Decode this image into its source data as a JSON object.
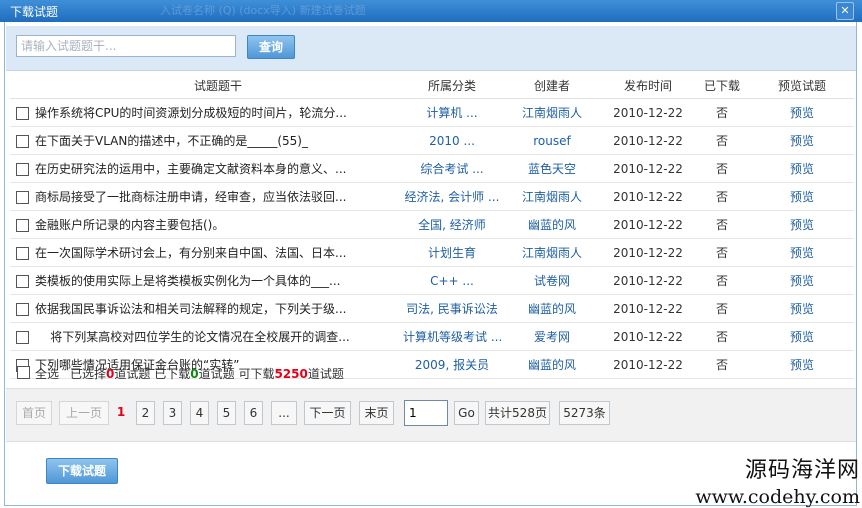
{
  "window": {
    "title": "下载试题",
    "ghost_text": "入试卷名称 (Q) (docx导入) 新建试卷试题"
  },
  "search": {
    "placeholder": "请输入试题题干...",
    "button_label": "查询"
  },
  "table": {
    "headers": [
      "",
      "试题题干",
      "所属分类",
      "创建者",
      "发布时间",
      "已下载",
      "预览试题"
    ],
    "rows": [
      {
        "title": "操作系统将CPU的时间资源划分成极短的时间片，轮流分...",
        "category": "计算机 ...",
        "author": "江南烟雨人",
        "date": "2010-12-22",
        "downloaded": "否",
        "preview": "预览"
      },
      {
        "title": "在下面关于VLAN的描述中，不正确的是_____(55)_",
        "category": "2010 ...",
        "author": "rousef",
        "date": "2010-12-22",
        "downloaded": "否",
        "preview": "预览"
      },
      {
        "title": "在历史研究法的运用中，主要确定文献资料本身的意义、...",
        "category": "综合考试 ...",
        "author": "蓝色天空",
        "date": "2010-12-22",
        "downloaded": "否",
        "preview": "预览"
      },
      {
        "title": "商标局接受了一批商标注册申请，经审查，应当依法驳回...",
        "category": "经济法, 会计师 ...",
        "author": "江南烟雨人",
        "date": "2010-12-22",
        "downloaded": "否",
        "preview": "预览"
      },
      {
        "title": "金融账户所记录的内容主要包括()。",
        "category": "全国, 经济师",
        "author": "幽蓝的风",
        "date": "2010-12-22",
        "downloaded": "否",
        "preview": "预览"
      },
      {
        "title": "在一次国际学术研讨会上，有分别来自中国、法国、日本...",
        "category": "计划生育",
        "author": "江南烟雨人",
        "date": "2010-12-22",
        "downloaded": "否",
        "preview": "预览"
      },
      {
        "title": "类模板的使用实际上是将类模板实例化为一个具体的___...",
        "category": "C++ ...",
        "author": "试卷网",
        "date": "2010-12-22",
        "downloaded": "否",
        "preview": "预览"
      },
      {
        "title": "依据我国民事诉讼法和相关司法解释的规定，下列关于级...",
        "category": "司法, 民事诉讼法",
        "author": "幽蓝的风",
        "date": "2010-12-22",
        "downloaded": "否",
        "preview": "预览"
      },
      {
        "title": "    将下列某高校对四位学生的论文情况在全校展开的调查...",
        "category": "计算机等级考试 ...",
        "author": "爱考网",
        "date": "2010-12-22",
        "downloaded": "否",
        "preview": "预览"
      },
      {
        "title": "下列哪些情况适用保证金台账的“实转”",
        "category": "2009, 报关员",
        "author": "幽蓝的风",
        "date": "2010-12-22",
        "downloaded": "否",
        "preview": "预览"
      }
    ]
  },
  "selection": {
    "select_all_label": "全选",
    "selected_prefix": "已选择",
    "selected_count": "0",
    "selected_suffix": "道试题",
    "downloaded_prefix": "已下载",
    "downloaded_count": "0",
    "downloaded_suffix": "道试题",
    "available_prefix": "可下载",
    "available_count": "5250",
    "available_suffix": "道试题"
  },
  "pager": {
    "first": "首页",
    "prev": "上一页",
    "current": "1",
    "pages": [
      "2",
      "3",
      "4",
      "5",
      "6"
    ],
    "ellipsis": "...",
    "next": "下一页",
    "last": "末页",
    "input_value": "1",
    "go": "Go",
    "total_pages": "共计528页",
    "total_items": "5273条"
  },
  "download_button": "下载试题",
  "watermark": {
    "line1": "源码海洋网",
    "line2": "www.codehy.com"
  }
}
